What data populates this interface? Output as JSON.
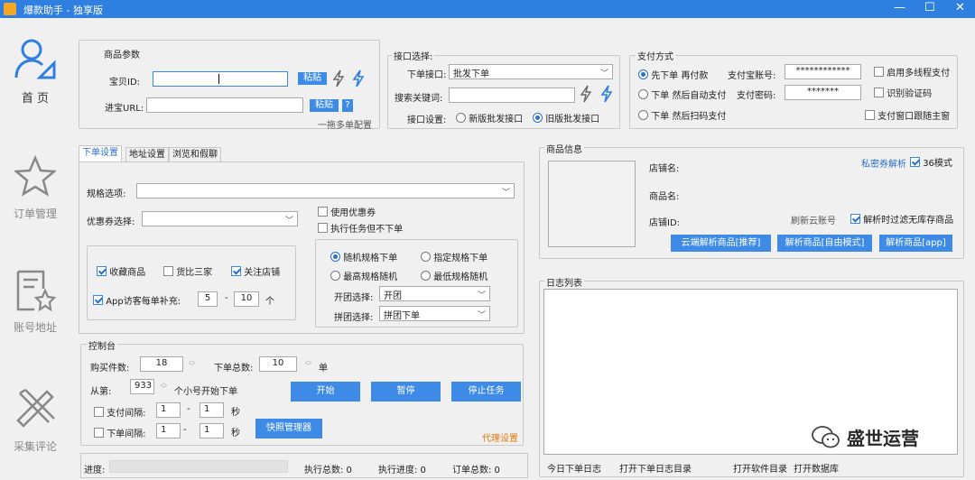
{
  "window": {
    "title": "爆款助手 - 独享版",
    "minimize": "—",
    "maximize": "☐",
    "close": "✕"
  },
  "nav": [
    {
      "label": "首 页",
      "icon": "user-icon",
      "active": true
    },
    {
      "label": "订单管理",
      "icon": "star-icon"
    },
    {
      "label": "账号地址",
      "icon": "document-star-icon"
    },
    {
      "label": "采集评论",
      "icon": "tools-icon"
    }
  ],
  "product_params": {
    "title": "商品参数",
    "item_id_label": "宝贝ID:",
    "item_id_value": "",
    "paste": "粘贴",
    "url_label": "进宝URL:",
    "url_value": "",
    "help": "?",
    "multi_hint": "一拖多单配置"
  },
  "api": {
    "title": "接口选择:",
    "order_api_label": "下单接口:",
    "order_api_value": "批发下单",
    "keyword_label": "搜索关键词:",
    "keyword_value": "",
    "setting_label": "接口设置:",
    "new_api": "新版批发接口",
    "old_api": "旧版批发接口"
  },
  "payment": {
    "title": "支付方式",
    "opt1": "先下单 再付款",
    "opt2": "下单 然后自动支付",
    "opt3": "下单 然后扫码支付",
    "alipay_label": "支付宝账号:",
    "alipay_value": "************",
    "pwd_label": "支付密码:",
    "pwd_value": "*******",
    "multithread": "启用多线程支付",
    "captcha": "识别验证码",
    "follow": "支付窗口跟随主窗"
  },
  "tabs": [
    "下单设置",
    "地址设置",
    "浏览和假聊"
  ],
  "order_settings": {
    "spec_label": "规格选项:",
    "spec_value": "",
    "coupon_label": "优惠券选择:",
    "coupon_value": "",
    "use_coupon": "使用优惠券",
    "exec_no_order": "执行任务但不下单",
    "fav": "收藏商品",
    "compare": "货比三家",
    "follow_shop": "关注店铺",
    "app_visitor": "App访客每单补充:",
    "visitor_min": "5",
    "visitor_sep": "-",
    "visitor_max": "10",
    "visitor_unit": "个",
    "random_spec": "随机规格下单",
    "fixed_spec": "指定规格下单",
    "high_spec": "最高规格随机",
    "low_spec": "最低规格随机",
    "group_open_label": "开团选择:",
    "group_open_value": "开团",
    "group_join_label": "拼团选择:",
    "group_join_value": "拼团下单"
  },
  "console": {
    "title": "控制台",
    "buy_count_label": "购买件数:",
    "buy_count": "18",
    "total_label": "下单总数:",
    "total": "10",
    "total_unit": "单",
    "from_label": "从第:",
    "from_value": "933",
    "from_suffix": "个小号开始下单",
    "start": "开始",
    "pause": "暂停",
    "stop": "停止任务",
    "pay_interval": "支付间隔:",
    "pay_min": "1",
    "pay_max": "1",
    "order_interval": "下单间隔:",
    "ord_min": "1",
    "ord_max": "1",
    "dash": "-",
    "sec": "秒",
    "snapshot": "快照管理器",
    "proxy": "代理设置"
  },
  "statusbar": {
    "progress_label": "进度:",
    "exec_total": "执行总数: 0",
    "exec_progress": "执行进度: 0",
    "order_total": "订单总数: 0"
  },
  "product_info": {
    "title": "商品信息",
    "shop_label": "店铺名:",
    "name_label": "商品名:",
    "shop_id_label": "店铺ID:",
    "coupon_parse": "私密券解析",
    "mode36": "36模式",
    "refresh_cloud": "刷新云账号",
    "filter_stock": "解析时过滤无库存商品",
    "cloud_parse": "云端解析商品[推荐]",
    "parse_free": "解析商品[自由模式]",
    "parse_app": "解析商品[app]"
  },
  "log": {
    "title": "日志列表",
    "today": "今日下单日志",
    "open_dir": "打开下单日志目录",
    "open_soft": "打开软件目录",
    "open_db": "打开数据库"
  },
  "watermark": "盛世运营",
  "colors": {
    "accent": "#3d8be6",
    "titlebar": "#2f7fe0"
  }
}
